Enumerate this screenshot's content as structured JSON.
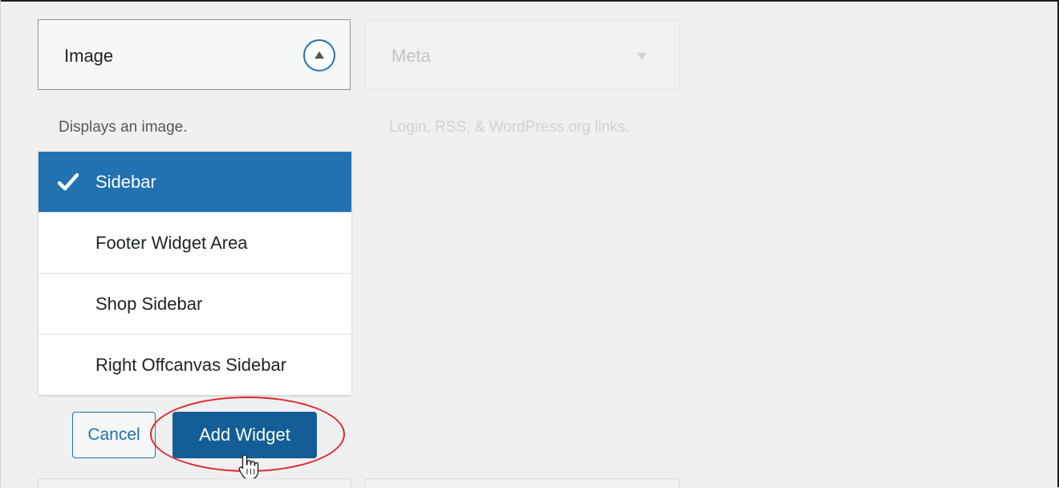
{
  "image_widget": {
    "title": "Image",
    "description": "Displays an image."
  },
  "meta_widget": {
    "title": "Meta",
    "description": "Login, RSS, & WordPress.org links."
  },
  "sidebar_chooser": {
    "items": [
      {
        "label": "Sidebar",
        "selected": true
      },
      {
        "label": "Footer Widget Area",
        "selected": false
      },
      {
        "label": "Shop Sidebar",
        "selected": false
      },
      {
        "label": "Right Offcanvas Sidebar",
        "selected": false
      }
    ]
  },
  "actions": {
    "cancel_label": "Cancel",
    "add_label": "Add Widget"
  },
  "colors": {
    "accent": "#2271b1",
    "primary_button": "#135e96",
    "highlight": "#e0282a",
    "background": "#f0f0f1"
  },
  "icons": {
    "toggle": "triangle-up-icon",
    "meta_toggle": "triangle-down-icon",
    "selected_mark": "check-icon",
    "cursor": "hand-pointer-icon"
  }
}
